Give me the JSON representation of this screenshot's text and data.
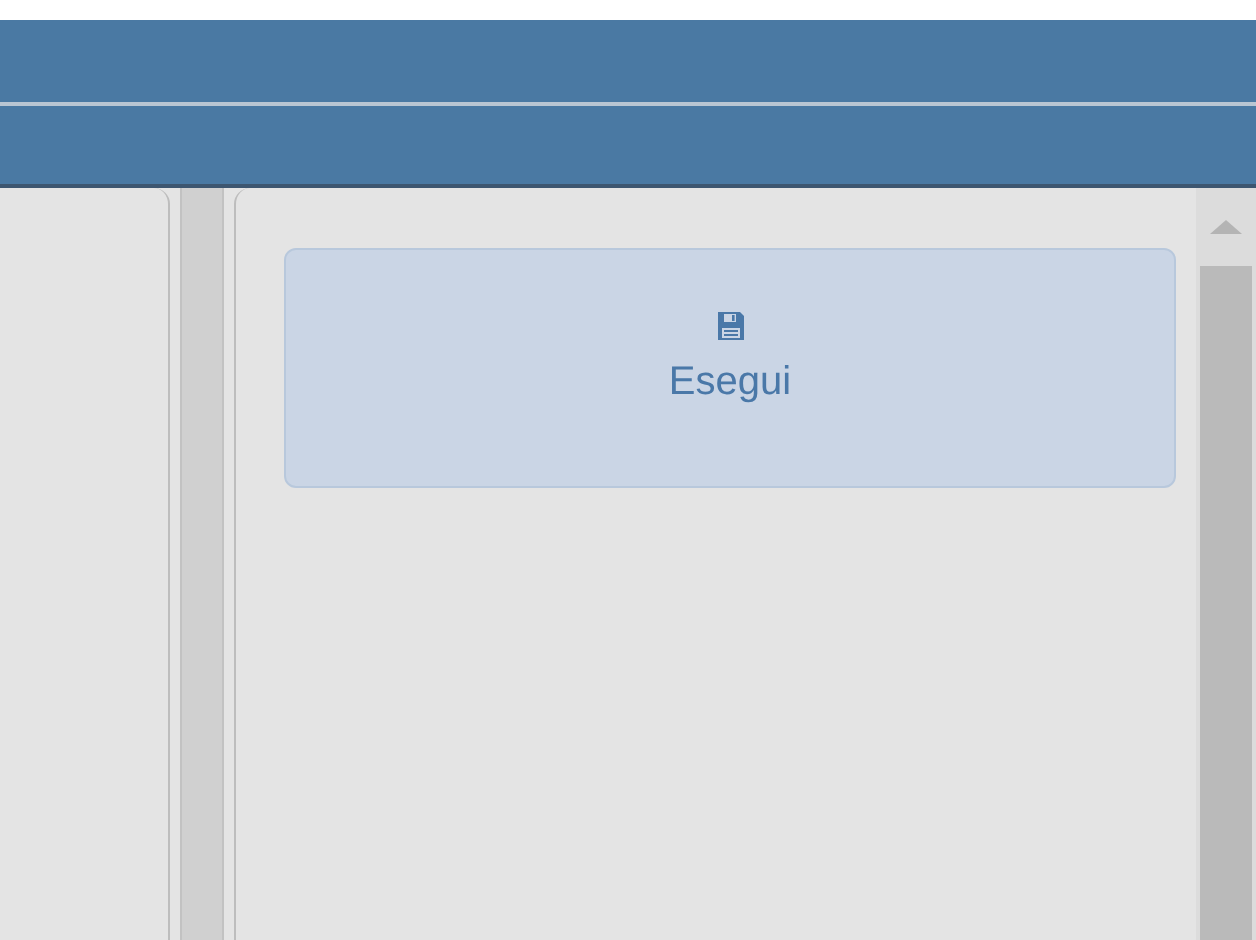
{
  "action_button": {
    "label": "Esegui"
  }
}
